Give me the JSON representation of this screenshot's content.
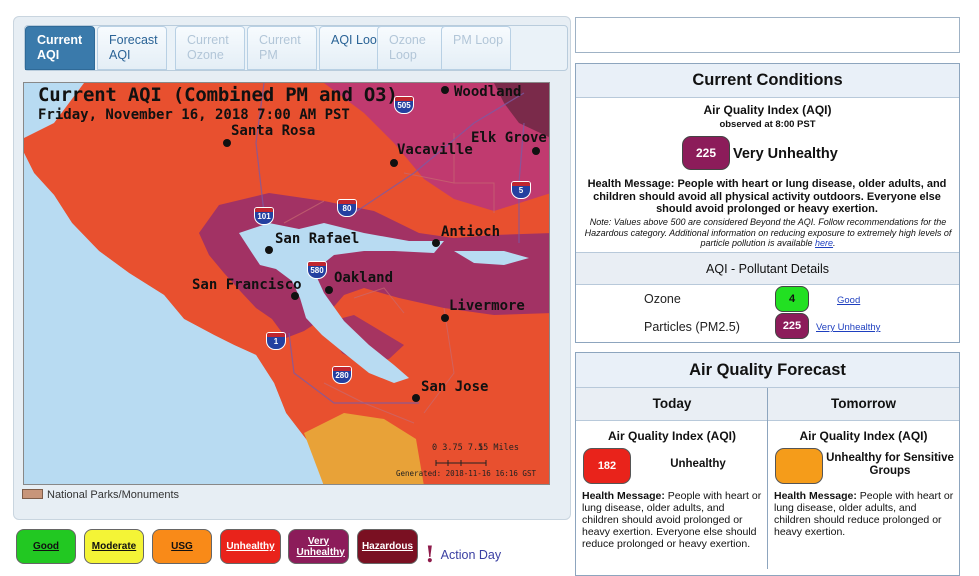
{
  "tabs": [
    {
      "label": "Current AQI",
      "state": "active"
    },
    {
      "label": "Forecast AQI",
      "state": "enabled"
    },
    {
      "label": "Current Ozone",
      "state": "disabled"
    },
    {
      "label": "Current PM",
      "state": "disabled"
    },
    {
      "label": "AQI Loop",
      "state": "enabled"
    },
    {
      "label": "Ozone Loop",
      "state": "disabled"
    },
    {
      "label": "PM Loop",
      "state": "disabled"
    }
  ],
  "map": {
    "title": "Current AQI (Combined PM and O3)",
    "date": "Friday, November 16, 2018 7:00 AM PST",
    "cities": [
      "Woodland",
      "Santa Rosa",
      "Vacaville",
      "Elk Grove",
      "San Rafael",
      "Antioch",
      "San Francisco",
      "Oakland",
      "Livermore",
      "San Jose"
    ],
    "highways": [
      "505",
      "5",
      "101",
      "80",
      "580",
      "1",
      "280"
    ],
    "scale": {
      "ticks": "0 3.75 7.5",
      "unit_label": "15 Miles"
    },
    "generated": "Generated: 2018-11-16 16:16 GST"
  },
  "legend": {
    "parks_label": "National Parks/Monuments",
    "categories": [
      {
        "label": "Good",
        "color": "#00e400"
      },
      {
        "label": "Moderate",
        "color": "#ffff00"
      },
      {
        "label": "USG",
        "color": "#ff7e00"
      },
      {
        "label": "Unhealthy",
        "color": "#ff0000"
      },
      {
        "label": "Very Unhealthy",
        "color": "#8f3f97"
      },
      {
        "label": "Hazardous",
        "color": "#7e0023"
      }
    ],
    "action_day": "Action Day"
  },
  "current_conditions": {
    "title": "Current Conditions",
    "aqi_label": "Air Quality Index (AQI)",
    "observed": "observed at 8:00 PST",
    "aqi_value": "225",
    "aqi_category": "Very Unhealthy",
    "health_message": "Health Message: People with heart or lung disease, older adults, and children should avoid all physical activity outdoors. Everyone else should avoid prolonged or heavy exertion.",
    "note": "Note: Values above 500 are considered Beyond the AQI. Follow recommendations for the Hazardous category. Additional information on reducing exposure to extremely high levels of particle pollution is available",
    "note_link": "here",
    "pollutant_header": "AQI - Pollutant Details",
    "pollutants": [
      {
        "name": "Ozone",
        "value": "4",
        "category": "Good",
        "color": "#00e400"
      },
      {
        "name": "Particles (PM2.5)",
        "value": "225",
        "category": "Very Unhealthy",
        "color": "#8f3f97"
      }
    ]
  },
  "forecast": {
    "title": "Air Quality Forecast",
    "days": [
      {
        "label": "Today",
        "aqi_label": "Air Quality Index (AQI)",
        "value": "182",
        "category": "Unhealthy",
        "color": "#ff0000",
        "health_label": "Health Message:",
        "health_text": "People with heart or lung disease, older adults, and children should avoid prolonged or heavy exertion. Everyone else should reduce prolonged or heavy exertion."
      },
      {
        "label": "Tomorrow",
        "aqi_label": "Air Quality Index (AQI)",
        "value": "",
        "category": "Unhealthy for Sensitive Groups",
        "color": "#ff9a00",
        "health_label": "Health Message:",
        "health_text": "People with heart or lung disease, older adults, and children should reduce prolonged or heavy exertion."
      }
    ]
  }
}
